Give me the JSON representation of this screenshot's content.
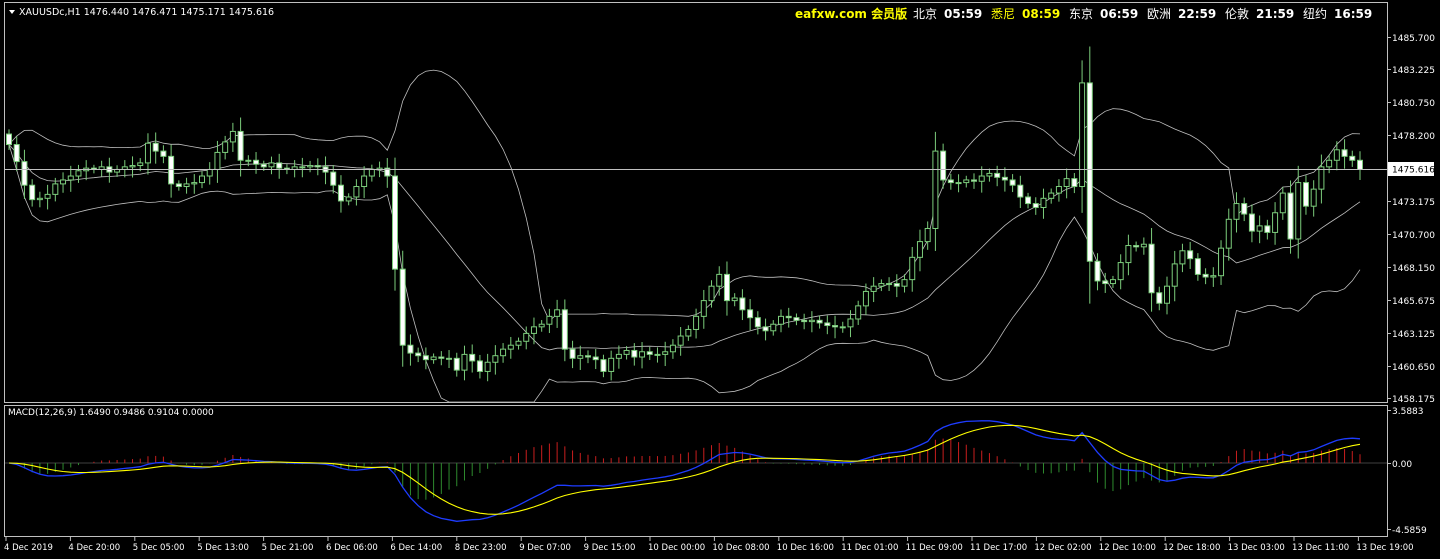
{
  "header": {
    "symbol_line": "XAUUSDc,H1  1476.440 1476.471 1475.171 1475.616",
    "brand": "eafxw.com 会员版",
    "clocks": [
      {
        "city": "北京",
        "time": "05:59",
        "color": "#ffffff"
      },
      {
        "city": "悉尼",
        "time": "08:59",
        "color": "#ffff00"
      },
      {
        "city": "东京",
        "time": "06:59",
        "color": "#ffffff"
      },
      {
        "city": "欧洲",
        "time": "22:59",
        "color": "#ffffff"
      },
      {
        "city": "伦敦",
        "time": "21:59",
        "color": "#ffffff"
      },
      {
        "city": "纽约",
        "time": "16:59",
        "color": "#ffffff"
      }
    ]
  },
  "price_axis": {
    "labels": [
      "1485.700",
      "1483.225",
      "1480.750",
      "1478.200",
      "1475.616",
      "1473.175",
      "1470.700",
      "1468.150",
      "1465.675",
      "1463.125",
      "1460.650",
      "1458.175"
    ],
    "current": "1475.616"
  },
  "macd": {
    "label": "MACD(12,26,9) 1.6490 0.9486 0.9104 0.0000",
    "axis_labels": [
      "3.5883",
      "0.00",
      "-4.5859"
    ]
  },
  "time_axis": {
    "labels": [
      "4 Dec 2019",
      "4 Dec 20:00",
      "5 Dec 05:00",
      "5 Dec 13:00",
      "5 Dec 21:00",
      "6 Dec 06:00",
      "6 Dec 14:00",
      "8 Dec 23:00",
      "9 Dec 07:00",
      "9 Dec 15:00",
      "10 Dec 00:00",
      "10 Dec 08:00",
      "10 Dec 16:00",
      "11 Dec 01:00",
      "11 Dec 09:00",
      "11 Dec 17:00",
      "12 Dec 02:00",
      "12 Dec 10:00",
      "12 Dec 18:00",
      "13 Dec 03:00",
      "13 Dec 11:00",
      "13 Dec 19:00"
    ]
  },
  "chart_data": {
    "type": "candlestick",
    "symbol": "XAUUSDc",
    "timeframe": "H1",
    "ylim": [
      1458.175,
      1485.7
    ],
    "current_price": 1475.616,
    "candle_color": "#7ccd7c",
    "bollinger_color": "#c0c0c0",
    "closes": [
      1477.5,
      1476.2,
      1474.4,
      1473.3,
      1473.4,
      1473.7,
      1474.5,
      1474.8,
      1475.1,
      1475.5,
      1475.7,
      1475.6,
      1475.8,
      1475.4,
      1475.6,
      1475.8,
      1475.9,
      1476.1,
      1477.6,
      1477.0,
      1476.6,
      1474.5,
      1474.3,
      1474.5,
      1474.6,
      1475.1,
      1475.6,
      1476.9,
      1477.7,
      1478.5,
      1476.3,
      1476.3,
      1476.0,
      1475.8,
      1476.1,
      1475.7,
      1475.6,
      1475.8,
      1475.8,
      1475.9,
      1475.8,
      1475.4,
      1474.4,
      1473.2,
      1473.5,
      1474.3,
      1475.1,
      1475.6,
      1475.7,
      1475.1,
      1468.0,
      1462.2,
      1461.6,
      1461.4,
      1461.1,
      1461.3,
      1461.2,
      1461.2,
      1460.3,
      1461.5,
      1461.0,
      1460.2,
      1460.9,
      1461.4,
      1461.9,
      1462.2,
      1462.5,
      1463.1,
      1463.6,
      1463.8,
      1464.4,
      1464.9,
      1461.9,
      1461.2,
      1461.4,
      1461.3,
      1461.1,
      1460.2,
      1461.2,
      1461.5,
      1461.8,
      1461.3,
      1461.7,
      1461.5,
      1461.5,
      1461.7,
      1462.2,
      1462.9,
      1463.4,
      1464.4,
      1465.6,
      1466.7,
      1467.6,
      1465.6,
      1465.8,
      1464.9,
      1464.3,
      1463.6,
      1463.3,
      1463.8,
      1464.4,
      1464.3,
      1464.1,
      1464.0,
      1464.1,
      1463.9,
      1463.7,
      1463.6,
      1463.6,
      1464.2,
      1465.2,
      1466.3,
      1466.7,
      1466.9,
      1466.9,
      1466.7,
      1467.2,
      1468.9,
      1470.1,
      1471.1,
      1477.0,
      1474.8,
      1474.6,
      1474.6,
      1474.8,
      1474.7,
      1475.1,
      1475.3,
      1475.0,
      1474.8,
      1474.4,
      1473.5,
      1473.0,
      1472.7,
      1473.4,
      1473.8,
      1474.3,
      1474.9,
      1474.3,
      1482.2,
      1468.6,
      1467.1,
      1466.9,
      1467.2,
      1468.5,
      1469.8,
      1469.7,
      1469.9,
      1466.2,
      1465.4,
      1466.7,
      1468.4,
      1469.4,
      1468.8,
      1467.6,
      1467.4,
      1467.5,
      1469.6,
      1471.8,
      1473.0,
      1472.2,
      1470.9,
      1471.3,
      1470.8,
      1472.3,
      1473.8,
      1470.3,
      1474.6,
      1472.8,
      1474.1,
      1475.8,
      1476.3,
      1477.1,
      1476.6,
      1476.3,
      1475.6
    ]
  }
}
